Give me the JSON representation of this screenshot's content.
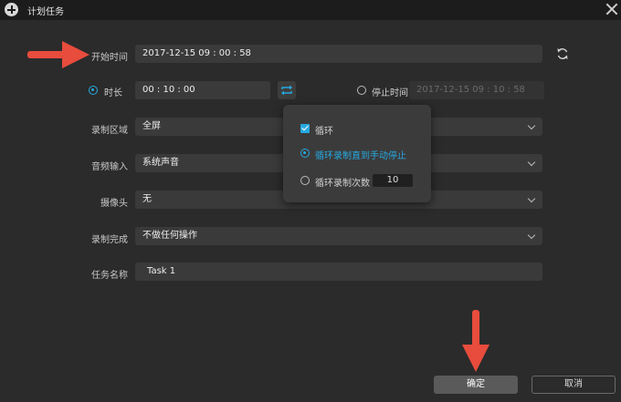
{
  "window": {
    "title": "计划任务"
  },
  "form": {
    "start_time": {
      "label": "开始时间",
      "value": "2017-12-15 09 : 00 : 58"
    },
    "duration": {
      "label": "时长",
      "value": "00 : 10 : 00",
      "selected": true
    },
    "stop_time": {
      "label": "停止时间",
      "value": "2017-12-15 09 : 10 : 58",
      "selected": false
    },
    "record_area": {
      "label": "录制区域",
      "value": "全屏"
    },
    "audio_input": {
      "label": "音频输入",
      "value": "系统声音"
    },
    "camera": {
      "label": "摄像头",
      "value": "无"
    },
    "on_complete": {
      "label": "录制完成",
      "value": "不做任何操作"
    },
    "task_name": {
      "label": "任务名称",
      "value": "Task 1"
    }
  },
  "loop_popup": {
    "loop_label": "循环",
    "loop_checked": true,
    "option_until_stop": "循环录制直到手动停止",
    "option_count": "循环录制次数",
    "count_value": "10",
    "selected_option": "until_stop"
  },
  "footer": {
    "ok_label": "确定",
    "cancel_label": "取消"
  },
  "colors": {
    "accent": "#27a9e1",
    "arrow": "#e84c3d",
    "background": "#2b2b2b"
  }
}
